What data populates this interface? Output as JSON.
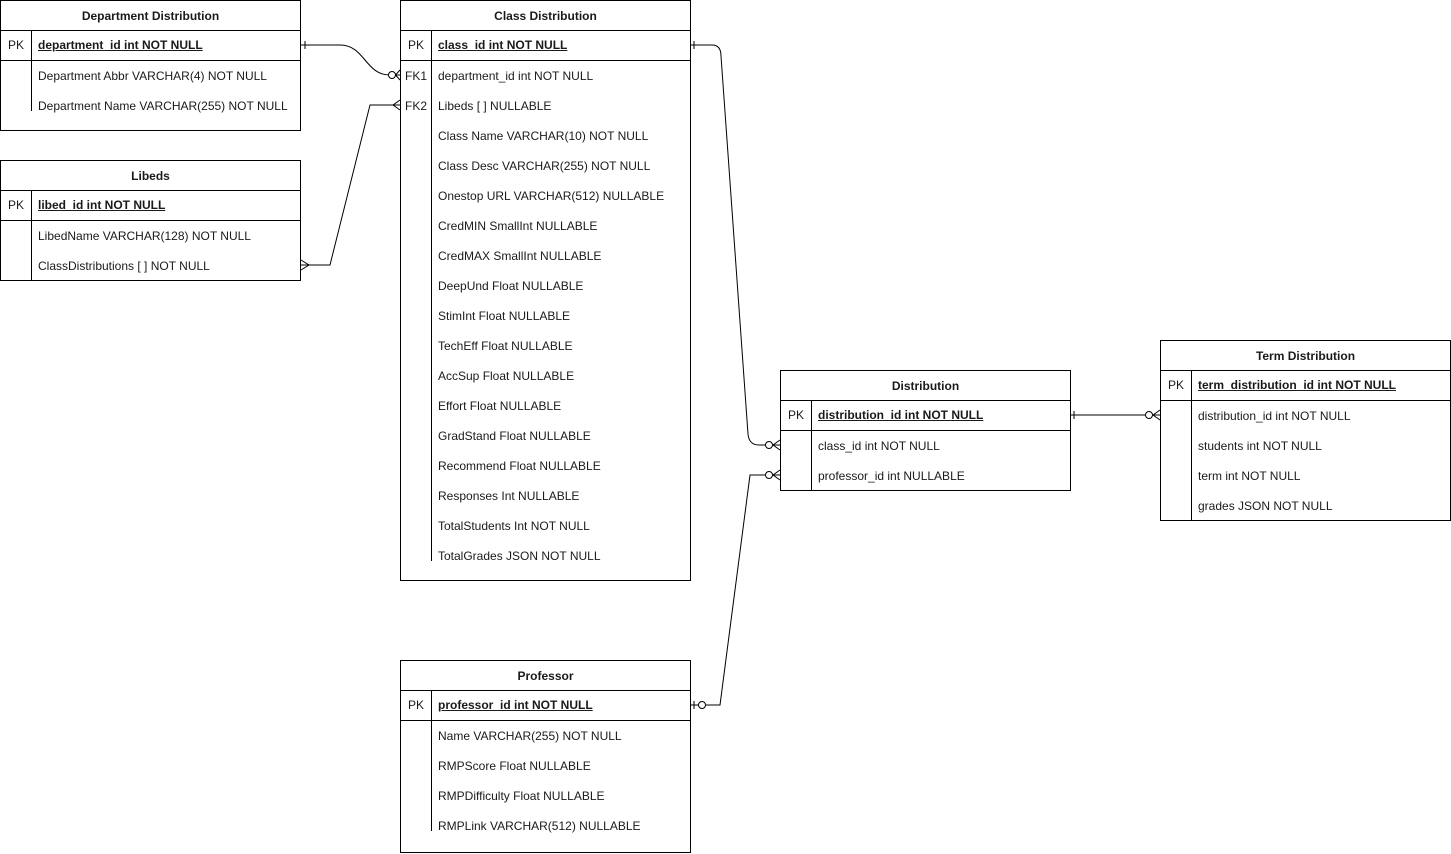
{
  "entities": {
    "department": {
      "title": "Department Distribution",
      "pk_label": "PK",
      "pk_field": "department_id int NOT NULL",
      "fields": [
        {
          "key": "",
          "name": "Department Abbr VARCHAR(4) NOT NULL"
        },
        {
          "key": "",
          "name": "Department Name VARCHAR(255) NOT NULL"
        }
      ]
    },
    "libeds": {
      "title": "Libeds",
      "pk_label": "PK",
      "pk_field": "libed_id int NOT NULL",
      "fields": [
        {
          "key": "",
          "name": "LibedName VARCHAR(128) NOT NULL"
        },
        {
          "key": "",
          "name": "ClassDistributions [ ] NOT NULL"
        }
      ]
    },
    "class": {
      "title": "Class Distribution",
      "pk_label": "PK",
      "pk_field": "class_id int NOT NULL",
      "fields": [
        {
          "key": "FK1",
          "name": "department_id int NOT NULL"
        },
        {
          "key": "FK2",
          "name": "Libeds [ ] NULLABLE"
        },
        {
          "key": "",
          "name": "Class Name VARCHAR(10) NOT NULL"
        },
        {
          "key": "",
          "name": "Class Desc VARCHAR(255) NOT NULL"
        },
        {
          "key": "",
          "name": "Onestop URL VARCHAR(512) NULLABLE"
        },
        {
          "key": "",
          "name": "CredMIN SmallInt NULLABLE"
        },
        {
          "key": "",
          "name": "CredMAX SmallInt NULLABLE"
        },
        {
          "key": "",
          "name": "DeepUnd Float NULLABLE"
        },
        {
          "key": "",
          "name": "StimInt Float NULLABLE"
        },
        {
          "key": "",
          "name": "TechEff Float NULLABLE"
        },
        {
          "key": "",
          "name": "AccSup Float NULLABLE"
        },
        {
          "key": "",
          "name": "Effort Float NULLABLE"
        },
        {
          "key": "",
          "name": "GradStand Float NULLABLE"
        },
        {
          "key": "",
          "name": "Recommend Float NULLABLE"
        },
        {
          "key": "",
          "name": "Responses Int NULLABLE"
        },
        {
          "key": "",
          "name": "TotalStudents Int NOT NULL"
        },
        {
          "key": "",
          "name": "TotalGrades JSON NOT NULL"
        }
      ]
    },
    "distribution": {
      "title": "Distribution",
      "pk_label": "PK",
      "pk_field": "distribution_id int NOT NULL",
      "fields": [
        {
          "key": "",
          "name": "class_id int NOT NULL"
        },
        {
          "key": "",
          "name": "professor_id int NULLABLE"
        }
      ]
    },
    "term": {
      "title": "Term Distribution",
      "pk_label": "PK",
      "pk_field": "term_distribution_id int NOT NULL",
      "fields": [
        {
          "key": "",
          "name": "distribution_id int NOT NULL"
        },
        {
          "key": "",
          "name": "students int NOT NULL"
        },
        {
          "key": "",
          "name": "term int NOT NULL"
        },
        {
          "key": "",
          "name": "grades JSON NOT NULL"
        }
      ]
    },
    "professor": {
      "title": "Professor",
      "pk_label": "PK",
      "pk_field": "professor_id int NOT NULL",
      "fields": [
        {
          "key": "",
          "name": "Name VARCHAR(255) NOT NULL"
        },
        {
          "key": "",
          "name": "RMPScore Float NULLABLE"
        },
        {
          "key": "",
          "name": "RMPDifficulty Float NULLABLE"
        },
        {
          "key": "",
          "name": "RMPLink VARCHAR(512) NULLABLE"
        }
      ]
    }
  },
  "relationships": [
    {
      "from": "Department Distribution.department_id",
      "to": "Class Distribution.department_id",
      "from_card": "one",
      "to_card": "zero-or-many"
    },
    {
      "from": "Libeds.ClassDistributions",
      "to": "Class Distribution.Libeds",
      "from_card": "many",
      "to_card": "many"
    },
    {
      "from": "Class Distribution.class_id",
      "to": "Distribution.class_id",
      "from_card": "one",
      "to_card": "zero-or-many"
    },
    {
      "from": "Professor.professor_id",
      "to": "Distribution.professor_id",
      "from_card": "zero-or-one",
      "to_card": "zero-or-many"
    },
    {
      "from": "Distribution.distribution_id",
      "to": "Term Distribution.distribution_id",
      "from_card": "one",
      "to_card": "zero-or-many"
    }
  ]
}
